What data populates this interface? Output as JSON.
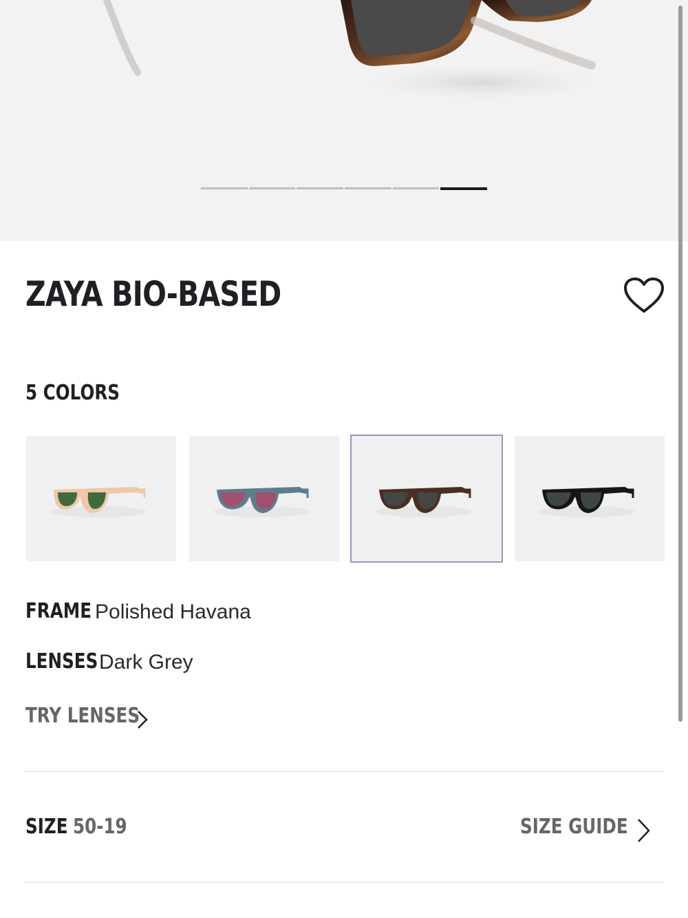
{
  "product": {
    "title": "ZAYA BIO-BASED",
    "colors_label": "5 COLORS",
    "frame_label": "FRAME",
    "frame_value": "Polished Havana",
    "lenses_label": "LENSES",
    "lenses_value": "Dark Grey",
    "try_lenses": "TRY LENSES",
    "size_label": "SIZE",
    "size_value": "50-19",
    "size_guide": "SIZE GUIDE"
  },
  "gallery": {
    "slide_count": 6,
    "active_slide": 6
  },
  "swatches": [
    {
      "frame": "#eec8a8",
      "lens": "#3f6a3c",
      "selected": false
    },
    {
      "frame": "#5c7d8e",
      "lens": "#a24f6d",
      "selected": false
    },
    {
      "frame": "#4a2e22",
      "lens": "#454545",
      "selected": true
    },
    {
      "frame": "#161616",
      "lens": "#3d463f",
      "selected": false
    }
  ],
  "icons": {
    "favorite": "heart-outline-icon",
    "try_lenses_arrow": "chevron-right-icon",
    "size_guide_arrow": "chevron-right-icon"
  },
  "colors": {
    "hero_bg": "#f2f2f2",
    "text_dark": "#1f1f24",
    "text_muted": "#666666",
    "selected_outline": "#9a97b8"
  }
}
